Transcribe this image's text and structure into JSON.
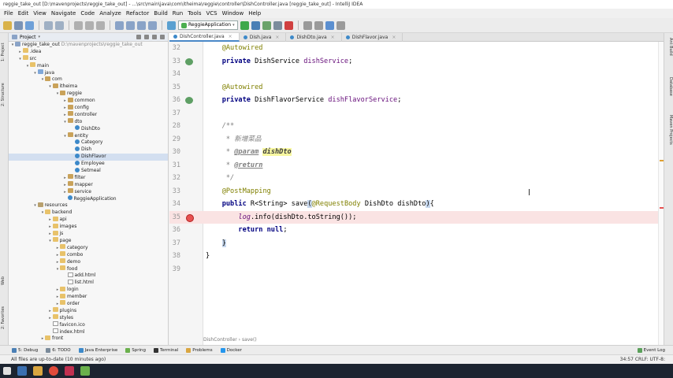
{
  "window_title": "reggie_take_out [D:\\mavenprojects\\reggie_take_out] - ...\\src\\main\\java\\com\\itheima\\reggie\\controller\\DishController.java [reggie_take_out] - IntelliJ IDEA",
  "menu": [
    "File",
    "Edit",
    "View",
    "Navigate",
    "Code",
    "Analyze",
    "Refactor",
    "Build",
    "Run",
    "Tools",
    "VCS",
    "Window",
    "Help"
  ],
  "run_config": "ReggieApplication",
  "left_vtabs": [
    "1: Project",
    "2: Structure",
    "Web",
    "2: Favorites"
  ],
  "right_vtabs": [
    "Ant Build",
    "Database",
    "Maven Projects"
  ],
  "project_panel": {
    "title": "Project",
    "rows": [
      {
        "indent": 0,
        "arrow": "▾",
        "icon": "proj",
        "label": "reggie_take_out",
        "extra": "D:\\mavenprojects\\reggie_take_out"
      },
      {
        "indent": 1,
        "arrow": "▸",
        "icon": "folder",
        "label": ".idea",
        "extra": ""
      },
      {
        "indent": 1,
        "arrow": "▾",
        "icon": "folder",
        "label": "src",
        "extra": ""
      },
      {
        "indent": 2,
        "arrow": "▾",
        "icon": "folder",
        "label": "main",
        "extra": ""
      },
      {
        "indent": 3,
        "arrow": "▾",
        "icon": "src",
        "label": "java",
        "extra": ""
      },
      {
        "indent": 4,
        "arrow": "▾",
        "icon": "pkg",
        "label": "com",
        "extra": ""
      },
      {
        "indent": 5,
        "arrow": "▾",
        "icon": "pkg",
        "label": "itheima",
        "extra": ""
      },
      {
        "indent": 6,
        "arrow": "▾",
        "icon": "pkg",
        "label": "reggie",
        "extra": ""
      },
      {
        "indent": 7,
        "arrow": "▸",
        "icon": "pkg",
        "label": "common",
        "extra": ""
      },
      {
        "indent": 7,
        "arrow": "▸",
        "icon": "pkg",
        "label": "config",
        "extra": ""
      },
      {
        "indent": 7,
        "arrow": "▸",
        "icon": "pkg",
        "label": "controller",
        "extra": ""
      },
      {
        "indent": 7,
        "arrow": "▾",
        "icon": "pkg",
        "label": "dto",
        "extra": ""
      },
      {
        "indent": 8,
        "arrow": "",
        "icon": "cls",
        "label": "DishDto",
        "extra": ""
      },
      {
        "indent": 7,
        "arrow": "▾",
        "icon": "pkg",
        "label": "entity",
        "extra": ""
      },
      {
        "indent": 8,
        "arrow": "",
        "icon": "cls",
        "label": "Category",
        "extra": ""
      },
      {
        "indent": 8,
        "arrow": "",
        "icon": "cls",
        "label": "Dish",
        "extra": ""
      },
      {
        "indent": 8,
        "arrow": "",
        "icon": "cls",
        "label": "DishFlavor",
        "extra": "",
        "selected": true
      },
      {
        "indent": 8,
        "arrow": "",
        "icon": "cls",
        "label": "Employee",
        "extra": ""
      },
      {
        "indent": 8,
        "arrow": "",
        "icon": "cls",
        "label": "Setmeal",
        "extra": ""
      },
      {
        "indent": 7,
        "arrow": "▸",
        "icon": "pkg",
        "label": "filter",
        "extra": ""
      },
      {
        "indent": 7,
        "arrow": "▸",
        "icon": "pkg",
        "label": "mapper",
        "extra": ""
      },
      {
        "indent": 7,
        "arrow": "▸",
        "icon": "pkg",
        "label": "service",
        "extra": ""
      },
      {
        "indent": 7,
        "arrow": "",
        "icon": "cls",
        "label": "ReggieApplication",
        "extra": ""
      },
      {
        "indent": 3,
        "arrow": "▾",
        "icon": "res",
        "label": "resources",
        "extra": ""
      },
      {
        "indent": 4,
        "arrow": "▾",
        "icon": "folder",
        "label": "backend",
        "extra": ""
      },
      {
        "indent": 5,
        "arrow": "▸",
        "icon": "folder",
        "label": "api",
        "extra": ""
      },
      {
        "indent": 5,
        "arrow": "▸",
        "icon": "folder",
        "label": "images",
        "extra": ""
      },
      {
        "indent": 5,
        "arrow": "▸",
        "icon": "folder",
        "label": "js",
        "extra": ""
      },
      {
        "indent": 5,
        "arrow": "▾",
        "icon": "folder",
        "label": "page",
        "extra": ""
      },
      {
        "indent": 6,
        "arrow": "▸",
        "icon": "folder",
        "label": "category",
        "extra": ""
      },
      {
        "indent": 6,
        "arrow": "▸",
        "icon": "folder",
        "label": "combo",
        "extra": ""
      },
      {
        "indent": 6,
        "arrow": "▸",
        "icon": "folder",
        "label": "demo",
        "extra": ""
      },
      {
        "indent": 6,
        "arrow": "▾",
        "icon": "folder",
        "label": "food",
        "extra": ""
      },
      {
        "indent": 7,
        "arrow": "",
        "icon": "file",
        "label": "add.html",
        "extra": ""
      },
      {
        "indent": 7,
        "arrow": "",
        "icon": "file",
        "label": "list.html",
        "extra": ""
      },
      {
        "indent": 6,
        "arrow": "▸",
        "icon": "folder",
        "label": "login",
        "extra": ""
      },
      {
        "indent": 6,
        "arrow": "▸",
        "icon": "folder",
        "label": "member",
        "extra": ""
      },
      {
        "indent": 6,
        "arrow": "▸",
        "icon": "folder",
        "label": "order",
        "extra": ""
      },
      {
        "indent": 5,
        "arrow": "▸",
        "icon": "folder",
        "label": "plugins",
        "extra": ""
      },
      {
        "indent": 5,
        "arrow": "▸",
        "icon": "folder",
        "label": "styles",
        "extra": ""
      },
      {
        "indent": 5,
        "arrow": "",
        "icon": "file",
        "label": "favicon.ico",
        "extra": ""
      },
      {
        "indent": 5,
        "arrow": "",
        "icon": "file",
        "label": "index.html",
        "extra": ""
      },
      {
        "indent": 4,
        "arrow": "▸",
        "icon": "folder",
        "label": "front",
        "extra": ""
      }
    ]
  },
  "tabs": [
    {
      "label": "DishController.java",
      "active": true
    },
    {
      "label": "Dish.java",
      "active": false
    },
    {
      "label": "DishDto.java",
      "active": false
    },
    {
      "label": "DishFlavor.java",
      "active": false
    }
  ],
  "editor": {
    "lines": [
      {
        "n": "32",
        "html": "    <span class=\"ann\">@Autowired</span>"
      },
      {
        "n": "33",
        "html": "    <span class=\"kw\">private</span> DishService <span class=\"field\">dishService</span>;",
        "mark": "impl"
      },
      {
        "n": "34",
        "html": ""
      },
      {
        "n": "35",
        "html": "    <span class=\"ann\">@Autowired</span>"
      },
      {
        "n": "36",
        "html": "    <span class=\"kw\">private</span> DishFlavorService <span class=\"field\">dishFlavorService</span>;",
        "mark": "impl"
      },
      {
        "n": "37",
        "html": ""
      },
      {
        "n": "28",
        "html": "    <span class=\"cmt\">/**</span>"
      },
      {
        "n": "29",
        "html": "    <span class=\"cmt\"> * 新增菜品</span>"
      },
      {
        "n": "30",
        "html": "    <span class=\"cmt\"> * </span><span class=\"tag\">@param</span> <span class=\"param-hl\">dishDto</span>"
      },
      {
        "n": "31",
        "html": "    <span class=\"cmt\"> * </span><span class=\"tag\">@return</span>"
      },
      {
        "n": "32",
        "html": "    <span class=\"cmt\"> */</span>"
      },
      {
        "n": "33",
        "html": "    <span class=\"ann\">@PostMapping</span>"
      },
      {
        "n": "34",
        "html": "    <span class=\"kw\">public</span> R&lt;String&gt; save<span class=\"brace-hl\">(</span><span class=\"ann\">@RequestBody</span> DishDto dishDto<span class=\"brace-hl\">)</span>{"
      },
      {
        "n": "35",
        "html": "        <span class=\"field-i\">log</span>.info(dishDto.toString());",
        "mark": "bp"
      },
      {
        "n": "36",
        "html": "        <span class=\"kw\">return null</span>;"
      },
      {
        "n": "37",
        "html": "    <span class=\"brace-hl\">}</span>"
      },
      {
        "n": "38",
        "html": "}"
      },
      {
        "n": "39",
        "html": ""
      }
    ],
    "breadcrumb": "DishController › save()"
  },
  "bottom_tools": [
    "5: Debug",
    "6: TODO",
    "Java Enterprise",
    "Spring",
    "Terminal",
    "Problems",
    "Docker"
  ],
  "event_log": "Event Log",
  "status": {
    "message": "All files are up-to-date (10 minutes ago)",
    "right": "34:57   CRLF:   UTF-8:"
  },
  "colors": {
    "accent": "#4a88c7",
    "breakpoint": "#e85050",
    "keyword": "#000080",
    "annotation": "#808000"
  }
}
